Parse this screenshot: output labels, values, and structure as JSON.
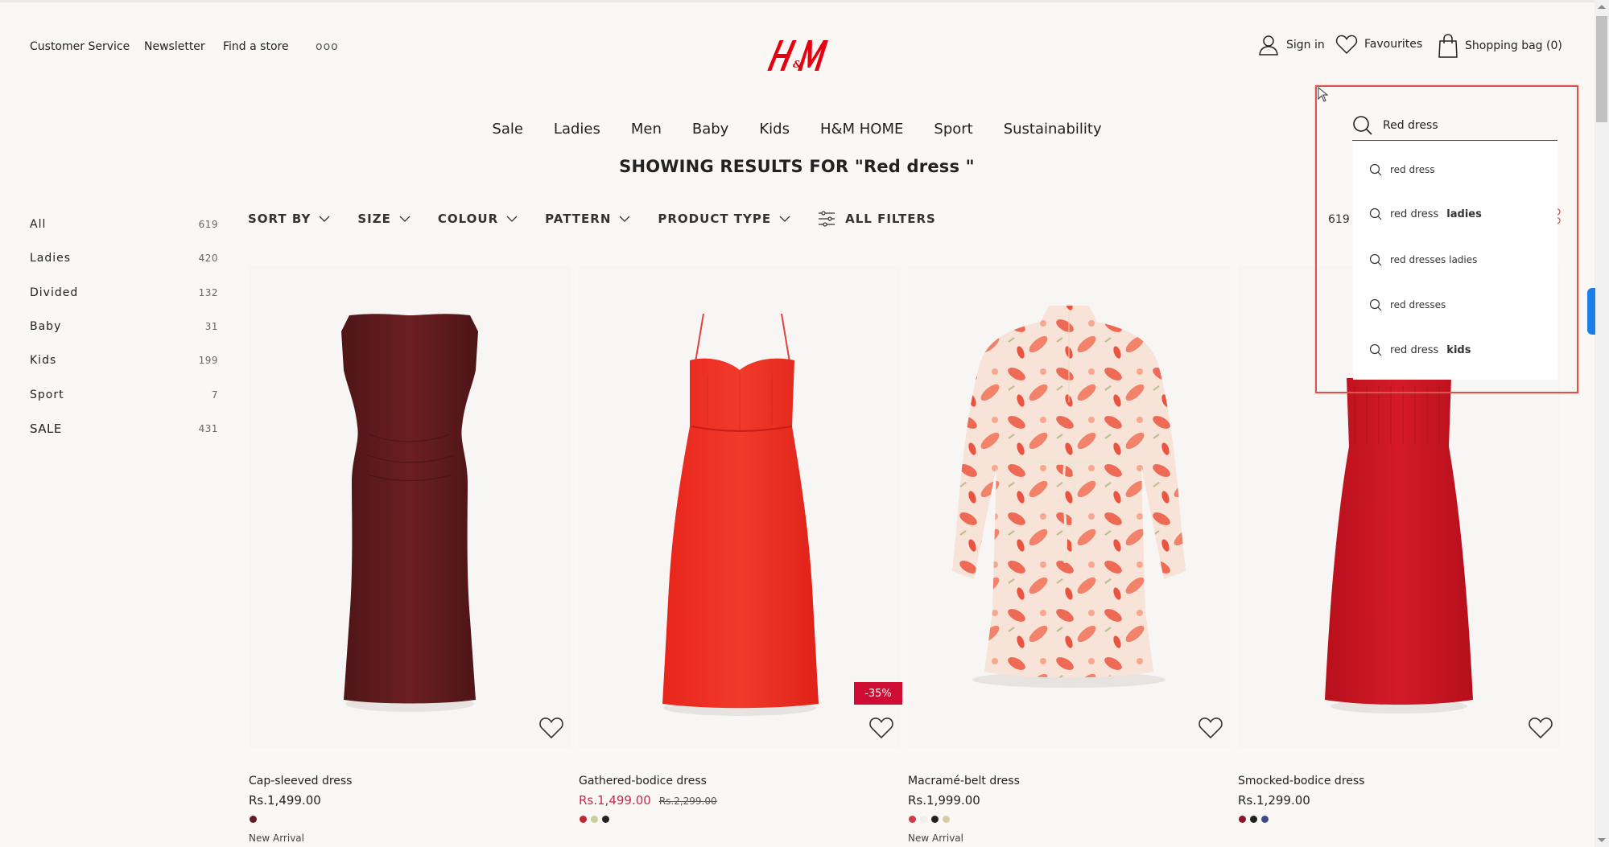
{
  "utility_nav": {
    "links": [
      "Customer Service",
      "Newsletter",
      "Find a store"
    ],
    "more_label": "ooo"
  },
  "brand": {
    "logo_text": "H&M",
    "color": "#e50010"
  },
  "account": {
    "sign_in": "Sign in",
    "favourites": "Favourites",
    "bag": "Shopping bag (0)"
  },
  "main_nav": [
    "Sale",
    "Ladies",
    "Men",
    "Baby",
    "Kids",
    "H&M HOME",
    "Sport",
    "Sustainability"
  ],
  "results_title": "SHOWING RESULTS FOR \"Red dress \"",
  "sidebar": {
    "categories": [
      {
        "label": "All",
        "count": "619"
      },
      {
        "label": "Ladies",
        "count": "420"
      },
      {
        "label": "Divided",
        "count": "132"
      },
      {
        "label": "Baby",
        "count": "31"
      },
      {
        "label": "Kids",
        "count": "199"
      },
      {
        "label": "Sport",
        "count": "7"
      },
      {
        "label": "SALE",
        "count": "431"
      }
    ]
  },
  "filters": {
    "items": [
      "SORT BY",
      "SIZE",
      "COLOUR",
      "PATTERN",
      "PRODUCT TYPE"
    ],
    "all_filters": "ALL FILTERS"
  },
  "results_count": "619 i",
  "search": {
    "value": "Red dress",
    "suggestions": [
      {
        "base": "red dress",
        "emph": ""
      },
      {
        "base": "red dress",
        "emph": "ladies"
      },
      {
        "base": "red dresses ladies",
        "emph": ""
      },
      {
        "base": "red dresses",
        "emph": ""
      },
      {
        "base": "red dress",
        "emph": "kids"
      }
    ]
  },
  "products": [
    {
      "name": "Cap-sleeved dress",
      "price": "Rs.1,499.00",
      "old_price": "",
      "on_sale": false,
      "badge": "",
      "swatches": [
        "#5e1f24"
      ],
      "tag": "New Arrival"
    },
    {
      "name": "Gathered-bodice dress",
      "price": "Rs.1,499.00",
      "old_price": "Rs.2,299.00",
      "on_sale": true,
      "badge": "-35%",
      "swatches": [
        "#c0283a",
        "#c8cf9a",
        "#222222"
      ],
      "tag": ""
    },
    {
      "name": "Macramé-belt dress",
      "price": "Rs.1,999.00",
      "old_price": "",
      "on_sale": false,
      "badge": "",
      "swatches": [
        "#d33a44",
        "#f0efec",
        "#222222",
        "#d8cba6"
      ],
      "tag": "New Arrival"
    },
    {
      "name": "Smocked-bodice dress",
      "price": "Rs.1,299.00",
      "old_price": "",
      "on_sale": false,
      "badge": "",
      "swatches": [
        "#8a1628",
        "#222222",
        "#3f4a8c"
      ],
      "tag": ""
    }
  ],
  "colors": {
    "sale_price": "#c8284a",
    "badge_bg": "#cf0c32",
    "highlight_border": "#d9534f"
  }
}
